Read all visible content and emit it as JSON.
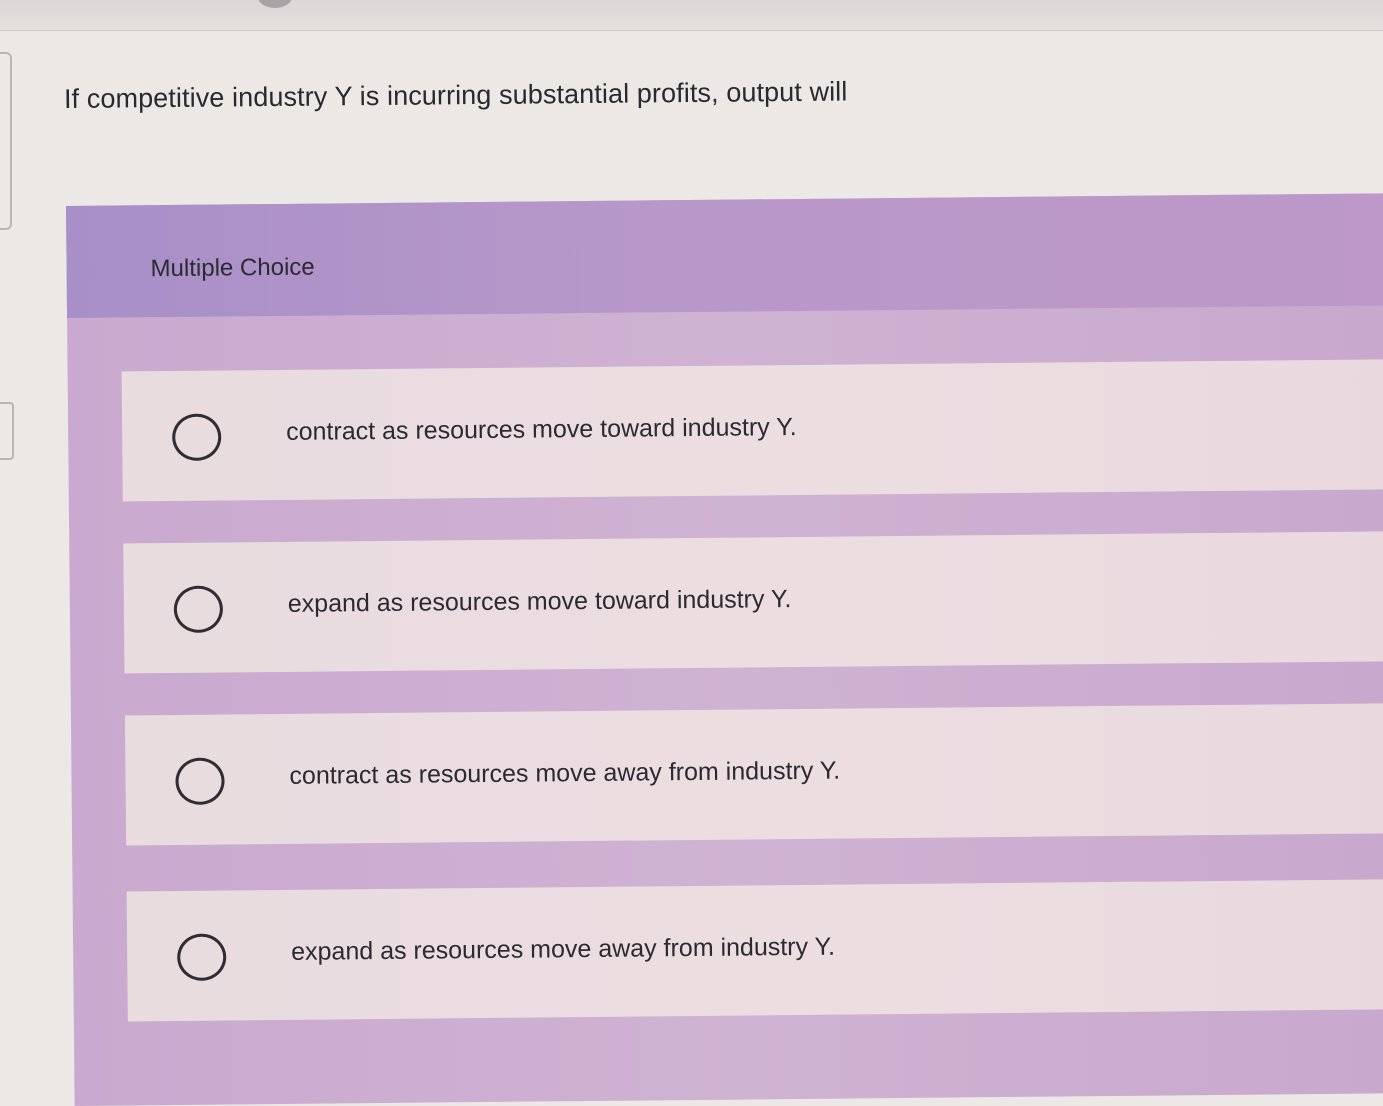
{
  "question": {
    "text": "If competitive industry Y is incurring substantial profits, output will"
  },
  "multiple_choice": {
    "header": "Multiple Choice",
    "options": [
      {
        "label": "contract as resources move toward industry Y."
      },
      {
        "label": "expand as resources move toward industry Y."
      },
      {
        "label": "contract as resources move away from industry Y."
      },
      {
        "label": "expand as resources move away from industry Y."
      }
    ]
  },
  "colors": {
    "header_purple": "#b898c9",
    "panel_purple": "#cfb3d2",
    "option_background": "#ecdde1",
    "page_background": "#ebe8e6"
  },
  "icons": {
    "radio": "radio-unselected-icon"
  }
}
